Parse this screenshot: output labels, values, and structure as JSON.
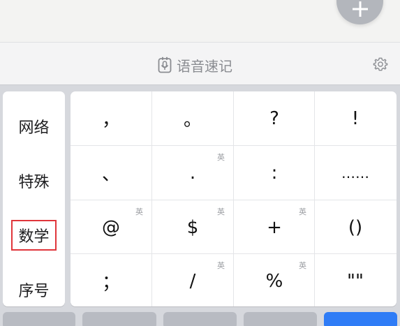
{
  "fab": {
    "icon": "plus-icon"
  },
  "toolbar": {
    "voice_label": "语音速记",
    "voice_icon": "voice-memo-icon",
    "settings_icon": "gear-icon"
  },
  "categories": [
    {
      "label": "网络",
      "selected": false
    },
    {
      "label": "特殊",
      "selected": false
    },
    {
      "label": "数学",
      "selected": true
    },
    {
      "label": "序号",
      "selected": false
    }
  ],
  "keys": [
    [
      {
        "label": "，",
        "sup": ""
      },
      {
        "label": "。",
        "sup": ""
      },
      {
        "label": "?",
        "sup": ""
      },
      {
        "label": "!",
        "sup": ""
      }
    ],
    [
      {
        "label": "、",
        "sup": ""
      },
      {
        "label": ".",
        "sup": "英"
      },
      {
        "label": ":",
        "sup": ""
      },
      {
        "label": "……",
        "sup": ""
      }
    ],
    [
      {
        "label": "@",
        "sup": "英"
      },
      {
        "label": "$",
        "sup": "英"
      },
      {
        "label": "+",
        "sup": "英"
      },
      {
        "label": "()",
        "sup": ""
      }
    ],
    [
      {
        "label": "；",
        "sup": ""
      },
      {
        "label": "/",
        "sup": "英"
      },
      {
        "label": "%",
        "sup": "英"
      },
      {
        "label": "\"\"",
        "sup": ""
      }
    ]
  ],
  "colors": {
    "selection_border": "#e0363b",
    "primary_key": "#2f7cf6",
    "icon_gray": "#8a8c91"
  }
}
